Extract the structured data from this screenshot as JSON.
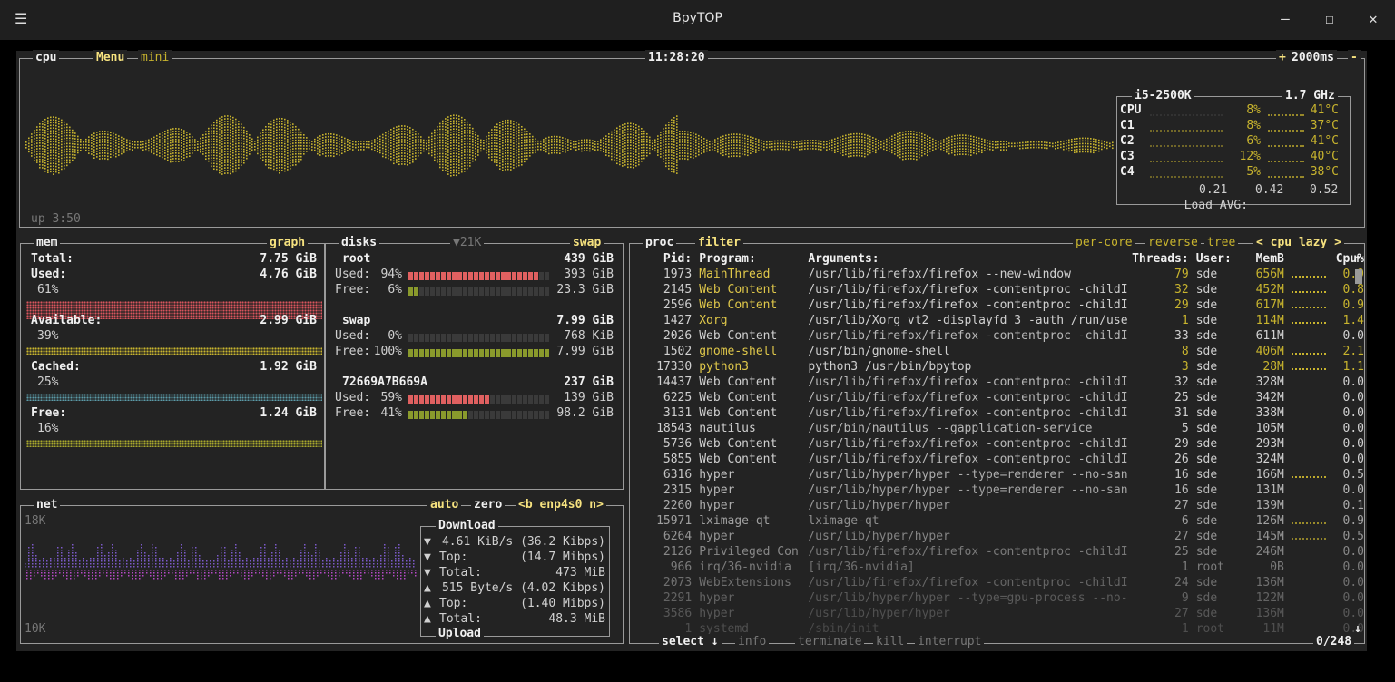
{
  "window": {
    "title": "BpyTOP",
    "menu_icon": "hamburger-icon",
    "minimize": "–",
    "maximize": "☐",
    "close": "✕"
  },
  "cpu": {
    "title": "cpu",
    "menu": "Menu",
    "mini": "mini",
    "clock": "11:28:20",
    "interval": "2000ms",
    "plus": "+",
    "minus": "-",
    "uptime": "up 3:50",
    "model": "i5-2500K",
    "freq": "1.7 GHz",
    "cores": [
      {
        "name": "CPU",
        "pct": "8%",
        "temp": "41°C",
        "level": 0.08
      },
      {
        "name": "C1",
        "pct": "8%",
        "temp": "37°C",
        "level": 0.08
      },
      {
        "name": "C2",
        "pct": "6%",
        "temp": "41°C",
        "level": 0.06
      },
      {
        "name": "C3",
        "pct": "12%",
        "temp": "40°C",
        "level": 0.12
      },
      {
        "name": "C4",
        "pct": "5%",
        "temp": "38°C",
        "level": 0.05
      }
    ],
    "load_label": "Load AVG:",
    "load": [
      "0.21",
      "0.42",
      "0.52"
    ]
  },
  "mem": {
    "title": "mem",
    "graph_btn": "graph",
    "total_label": "Total:",
    "total": "7.75 GiB",
    "items": [
      {
        "label": "Used:",
        "value": "4.76 GiB",
        "pct": "61%",
        "color": "#d9545d"
      },
      {
        "label": "Available:",
        "value": "2.99 GiB",
        "pct": "39%",
        "color": "#c8b42e"
      },
      {
        "label": "Cached:",
        "value": "1.92 GiB",
        "pct": "25%",
        "color": "#5b9aa8"
      },
      {
        "label": "Free:",
        "value": "1.24 GiB",
        "pct": "16%",
        "color": "#a6a62c"
      }
    ]
  },
  "disks": {
    "title": "disks",
    "swap_btn": "swap",
    "io": "▼21K",
    "items": [
      {
        "name": "root",
        "total": "439 GiB",
        "used_label": "Used:",
        "used_pct": "94%",
        "used": "393 GiB",
        "free_label": "Free:",
        "free_pct": "6%",
        "free": "23.3 GiB",
        "used_level": 0.94,
        "free_level": 0.06
      },
      {
        "name": "swap",
        "total": "7.99 GiB",
        "used_label": "Used:",
        "used_pct": "0%",
        "used": "768 KiB",
        "free_label": "Free:",
        "free_pct": "100%",
        "free": "7.99 GiB",
        "used_level": 0.0,
        "free_level": 1.0
      },
      {
        "name": "72669A7B669A",
        "total": "237 GiB",
        "used_label": "Used:",
        "used_pct": "59%",
        "used": "139 GiB",
        "free_label": "Free:",
        "free_pct": "41%",
        "free": "98.2 GiB",
        "used_level": 0.59,
        "free_level": 0.41
      }
    ]
  },
  "net": {
    "title": "net",
    "auto": "auto",
    "zero": "zero",
    "iface": "<b enp4s0 n>",
    "top_scale": "18K",
    "bottom_scale": "10K",
    "download_label": "Download",
    "upload_label": "Upload",
    "rows": [
      {
        "arrow": "▼",
        "label": "",
        "value": "4.61 KiB/s (36.2 Kibps)"
      },
      {
        "arrow": "▼",
        "label": "Top:",
        "value": "(14.7 Mibps)"
      },
      {
        "arrow": "▼",
        "label": "Total:",
        "value": "473 MiB"
      },
      {
        "arrow": "▲",
        "label": "",
        "value": "515 Byte/s (4.02 Kibps)"
      },
      {
        "arrow": "▲",
        "label": "Top:",
        "value": "(1.40 Mibps)"
      },
      {
        "arrow": "▲",
        "label": "Total:",
        "value": "48.3 MiB"
      }
    ]
  },
  "proc": {
    "title": "proc",
    "filter": "filter",
    "per_core": "per-core",
    "reverse": "reverse",
    "tree": "tree",
    "sort": "< cpu lazy >",
    "headers": {
      "pid": "Pid:",
      "program": "Program:",
      "args": "Arguments:",
      "threads": "Threads:",
      "user": "User:",
      "mem": "MemB",
      "cpu": "Cpu%"
    },
    "footer_select": "select ↓",
    "footer_info": "info",
    "footer_terminate": "terminate",
    "footer_kill": "kill",
    "footer_interrupt": "interrupt",
    "count": "0/248",
    "scroll_up": "↑",
    "scroll_down": "↓",
    "rows": [
      {
        "pid": "1973",
        "program": "MainThread",
        "args": "/usr/lib/firefox/firefox --new-window",
        "threads": "79",
        "user": "sde",
        "mem": "656M",
        "cpu": "0.9",
        "hot": true
      },
      {
        "pid": "2145",
        "program": "Web Content",
        "args": "/usr/lib/firefox/firefox -contentproc -childI",
        "threads": "32",
        "user": "sde",
        "mem": "452M",
        "cpu": "0.8",
        "hot": true
      },
      {
        "pid": "2596",
        "program": "Web Content",
        "args": "/usr/lib/firefox/firefox -contentproc -childI",
        "threads": "29",
        "user": "sde",
        "mem": "617M",
        "cpu": "0.9",
        "hot": true
      },
      {
        "pid": "1427",
        "program": "Xorg",
        "args": "/usr/lib/Xorg vt2 -displayfd 3 -auth /run/use",
        "threads": "1",
        "user": "sde",
        "mem": "114M",
        "cpu": "1.4",
        "hot": true
      },
      {
        "pid": "2026",
        "program": "Web Content",
        "args": "/usr/lib/firefox/firefox -contentproc -childI",
        "threads": "33",
        "user": "sde",
        "mem": "611M",
        "cpu": "0.0",
        "hot": false
      },
      {
        "pid": "1502",
        "program": "gnome-shell",
        "args": "/usr/bin/gnome-shell",
        "threads": "8",
        "user": "sde",
        "mem": "406M",
        "cpu": "2.1",
        "hot": true
      },
      {
        "pid": "17330",
        "program": "python3",
        "args": "python3 /usr/bin/bpytop",
        "threads": "3",
        "user": "sde",
        "mem": "28M",
        "cpu": "1.1",
        "hot": true
      },
      {
        "pid": "14437",
        "program": "Web Content",
        "args": "/usr/lib/firefox/firefox -contentproc -childI",
        "threads": "32",
        "user": "sde",
        "mem": "328M",
        "cpu": "0.0",
        "hot": false
      },
      {
        "pid": "6225",
        "program": "Web Content",
        "args": "/usr/lib/firefox/firefox -contentproc -childI",
        "threads": "25",
        "user": "sde",
        "mem": "342M",
        "cpu": "0.0",
        "hot": false
      },
      {
        "pid": "3131",
        "program": "Web Content",
        "args": "/usr/lib/firefox/firefox -contentproc -childI",
        "threads": "31",
        "user": "sde",
        "mem": "338M",
        "cpu": "0.0",
        "hot": false
      },
      {
        "pid": "18543",
        "program": "nautilus",
        "args": "/usr/bin/nautilus --gapplication-service",
        "threads": "5",
        "user": "sde",
        "mem": "105M",
        "cpu": "0.0",
        "hot": false
      },
      {
        "pid": "5736",
        "program": "Web Content",
        "args": "/usr/lib/firefox/firefox -contentproc -childI",
        "threads": "29",
        "user": "sde",
        "mem": "293M",
        "cpu": "0.0",
        "hot": false
      },
      {
        "pid": "5855",
        "program": "Web Content",
        "args": "/usr/lib/firefox/firefox -contentproc -childI",
        "threads": "26",
        "user": "sde",
        "mem": "324M",
        "cpu": "0.0",
        "hot": false
      },
      {
        "pid": "6316",
        "program": "hyper",
        "args": "/usr/lib/hyper/hyper --type=renderer --no-san",
        "threads": "16",
        "user": "sde",
        "mem": "166M",
        "cpu": "0.5",
        "hot": false
      },
      {
        "pid": "2315",
        "program": "hyper",
        "args": "/usr/lib/hyper/hyper --type=renderer --no-san",
        "threads": "16",
        "user": "sde",
        "mem": "131M",
        "cpu": "0.0",
        "hot": false
      },
      {
        "pid": "2260",
        "program": "hyper",
        "args": "/usr/lib/hyper/hyper",
        "threads": "27",
        "user": "sde",
        "mem": "139M",
        "cpu": "0.1",
        "hot": false
      },
      {
        "pid": "15971",
        "program": "lximage-qt",
        "args": "lximage-qt",
        "threads": "6",
        "user": "sde",
        "mem": "126M",
        "cpu": "0.9",
        "hot": false
      },
      {
        "pid": "6264",
        "program": "hyper",
        "args": "/usr/lib/hyper/hyper",
        "threads": "27",
        "user": "sde",
        "mem": "145M",
        "cpu": "0.5",
        "hot": false
      },
      {
        "pid": "2126",
        "program": "Privileged Con",
        "args": "/usr/lib/firefox/firefox -contentproc -childI",
        "threads": "25",
        "user": "sde",
        "mem": "246M",
        "cpu": "0.0",
        "hot": false
      },
      {
        "pid": "966",
        "program": "irq/36-nvidia",
        "args": "[irq/36-nvidia]",
        "threads": "1",
        "user": "root",
        "mem": "0B",
        "cpu": "0.0",
        "hot": false
      },
      {
        "pid": "2073",
        "program": "WebExtensions",
        "args": "/usr/lib/firefox/firefox -contentproc -childI",
        "threads": "24",
        "user": "sde",
        "mem": "136M",
        "cpu": "0.0",
        "hot": false
      },
      {
        "pid": "2291",
        "program": "hyper",
        "args": "/usr/lib/hyper/hyper --type=gpu-process --no-",
        "threads": "9",
        "user": "sde",
        "mem": "122M",
        "cpu": "0.0",
        "hot": false
      },
      {
        "pid": "3586",
        "program": "hyper",
        "args": "/usr/lib/hyper/hyper",
        "threads": "27",
        "user": "sde",
        "mem": "136M",
        "cpu": "0.0",
        "hot": false
      },
      {
        "pid": "1",
        "program": "systemd",
        "args": "/sbin/init",
        "threads": "1",
        "user": "root",
        "mem": "11M",
        "cpu": "0.0",
        "hot": false
      }
    ]
  },
  "colors": {
    "accent": "#f6e27f",
    "cpu_graph": "#c8b42e",
    "used": "#d9545d",
    "net": "#b548c6",
    "border": "#9a9a9a"
  }
}
